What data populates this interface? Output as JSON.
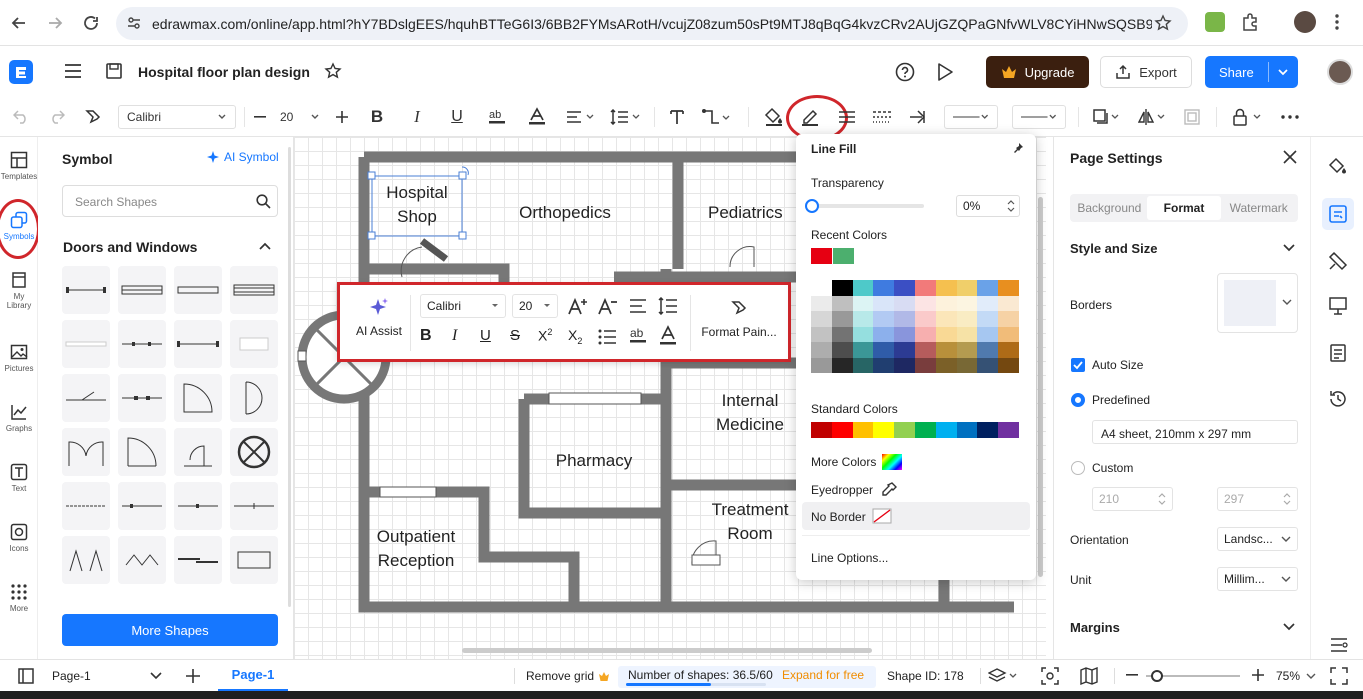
{
  "browser": {
    "url": "edrawmax.com/online/app.html?hY7BDslgEES/hquhBTTeG6I3/6BB2FYMsARotH/vcujZ08zum50sPt9MTJ8qBqG4kvzCRv2AUjGZQPaGNfvWLV8CYiHNwSQSB9Wv..."
  },
  "app": {
    "doc_title": "Hospital floor plan design",
    "upgrade_label": "Upgrade",
    "export_label": "Export",
    "share_label": "Share"
  },
  "toolbar": {
    "font": "Calibri",
    "font_size": "20"
  },
  "rail": [
    {
      "label": "Templates",
      "icon": "templates-icon"
    },
    {
      "label": "Symbols",
      "icon": "symbols-icon"
    },
    {
      "label": "My Library",
      "icon": "library-icon"
    },
    {
      "label": "Pictures",
      "icon": "pictures-icon"
    },
    {
      "label": "Graphs",
      "icon": "graphs-icon"
    },
    {
      "label": "Text",
      "icon": "text-icon"
    },
    {
      "label": "Icons",
      "icon": "icons-icon"
    },
    {
      "label": "More",
      "icon": "more-icon"
    }
  ],
  "symbol_panel": {
    "title": "Symbol",
    "ai_symbol": "AI Symbol",
    "search_placeholder": "Search Shapes",
    "section": "Doors and Windows",
    "more_shapes": "More Shapes"
  },
  "canvas": {
    "rooms": [
      "Hospital Shop",
      "Orthopedics",
      "Pediatrics",
      "Internal Medicine",
      "Pharmacy",
      "Treatment Room",
      "Outpatient Reception"
    ]
  },
  "floatbar": {
    "ai_assist": "AI Assist",
    "font": "Calibri",
    "font_size": "20",
    "format_painter": "Format Pain..."
  },
  "line_fill": {
    "title": "Line Fill",
    "transparency_label": "Transparency",
    "transparency_value": "0%",
    "recent_colors_label": "Recent Colors",
    "recent_colors": [
      "#e60012",
      "#4caf6e"
    ],
    "standard_colors_label": "Standard Colors",
    "standard_colors": [
      "#c00000",
      "#ff0000",
      "#ffc000",
      "#ffff00",
      "#92d050",
      "#00b050",
      "#00b0f0",
      "#0070c0",
      "#002060",
      "#7030a0"
    ],
    "more_colors": "More Colors",
    "eyedropper": "Eyedropper",
    "no_border": "No Border",
    "line_options": "Line Options..."
  },
  "page_settings": {
    "title": "Page Settings",
    "tabs": [
      "Background",
      "Format",
      "Watermark"
    ],
    "active_tab": "Format",
    "style_size": "Style and Size",
    "borders": "Borders",
    "auto_size": "Auto Size",
    "predefined": "Predefined",
    "paper": "A4 sheet, 210mm x 297 mm",
    "custom": "Custom",
    "width": "210",
    "height": "297",
    "orientation_label": "Orientation",
    "orientation_value": "Landsc...",
    "unit_label": "Unit",
    "unit_value": "Millim...",
    "margins": "Margins"
  },
  "status": {
    "page_select": "Page-1",
    "page_tab": "Page-1",
    "remove_grid": "Remove grid",
    "shapes_count": "Number of shapes: 36.5/60",
    "expand": "Expand for free",
    "shapes_progress": 0.608,
    "shape_id": "Shape ID: 178",
    "zoom": "75%",
    "zoom_level": 0.75
  },
  "colors": {
    "accent": "#1677ff",
    "highlight": "#d0262b",
    "upgrade_bg": "#3b1f0f"
  }
}
